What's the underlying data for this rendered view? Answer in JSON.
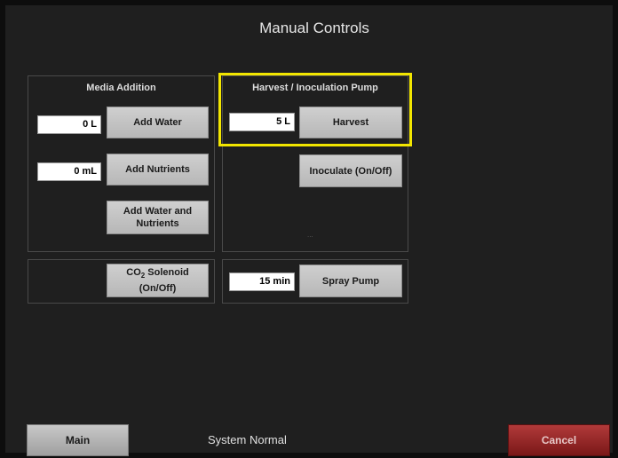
{
  "title": "Manual Controls",
  "media": {
    "title": "Media Addition",
    "water_value": "0 L",
    "add_water": "Add Water",
    "nutrients_value": "0 mL",
    "add_nutrients": "Add Nutrients",
    "add_both_line1": "Add Water and",
    "add_both_line2": "Nutrients"
  },
  "harvest": {
    "title": "Harvest / Inoculation Pump",
    "harvest_value": "5 L",
    "harvest_label": "Harvest",
    "inoculate_label": "Inoculate (On/Off)",
    "dots": "..."
  },
  "co2": {
    "label_prefix": "CO",
    "label_sub": "2",
    "label_suffix": " Solenoid",
    "label_line2": "(On/Off)"
  },
  "spray": {
    "value": "15 min",
    "label": "Spray Pump"
  },
  "footer": {
    "main_label": "Main",
    "status": "System Normal",
    "cancel_label": "Cancel"
  },
  "colors": {
    "highlight": "#f2e600",
    "cancel": "#8b1f1f"
  }
}
